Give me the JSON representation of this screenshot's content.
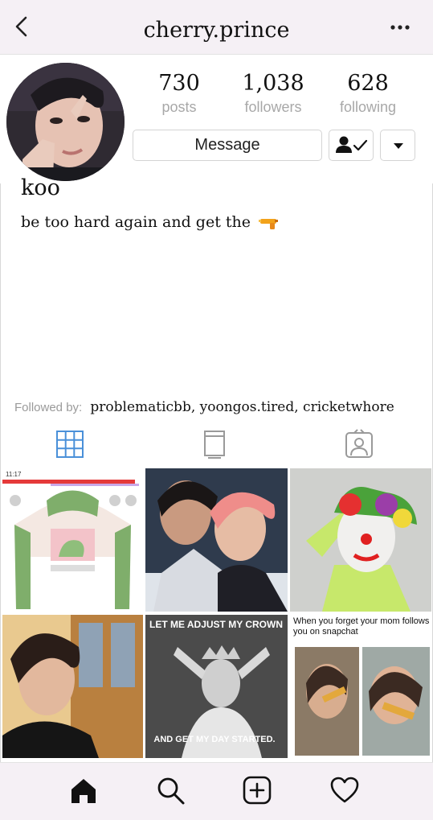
{
  "header": {
    "username": "cherry.prince",
    "back_icon": "chevron-left-icon",
    "more_icon": "more-horizontal-icon"
  },
  "stats": {
    "posts": {
      "value": "730",
      "label": "posts"
    },
    "followers": {
      "value": "1,038",
      "label": "followers"
    },
    "following": {
      "value": "628",
      "label": "following"
    }
  },
  "actions": {
    "message_label": "Message",
    "following_icon": "user-check-icon",
    "dropdown_icon": "caret-down-icon"
  },
  "profile": {
    "display_name": "koo",
    "bio": "be too hard again and get the",
    "bio_emoji": "water-pistol-icon",
    "followed_by_label": "Followed by:",
    "followed_by_names": "problematicbb, yoongos.tired, cricketwhore"
  },
  "tabs": [
    "grid-icon",
    "igtv-icon",
    "tagged-icon"
  ],
  "posts": {
    "tile1_status_time": "11:17",
    "tile4_caption": "LET ME ADJUST MY CROWN",
    "tile4_caption_bottom": "AND GET MY DAY STARTED.",
    "tile5_caption": "When you forget your mom follows you on snapchat"
  },
  "bottom_nav": [
    "home-icon",
    "search-icon",
    "add-post-icon",
    "activity-heart-icon"
  ],
  "colors": {
    "header_bg": "#f5f0f5",
    "muted_text": "#a8a8a8",
    "tab_active": "#4a90d9"
  }
}
